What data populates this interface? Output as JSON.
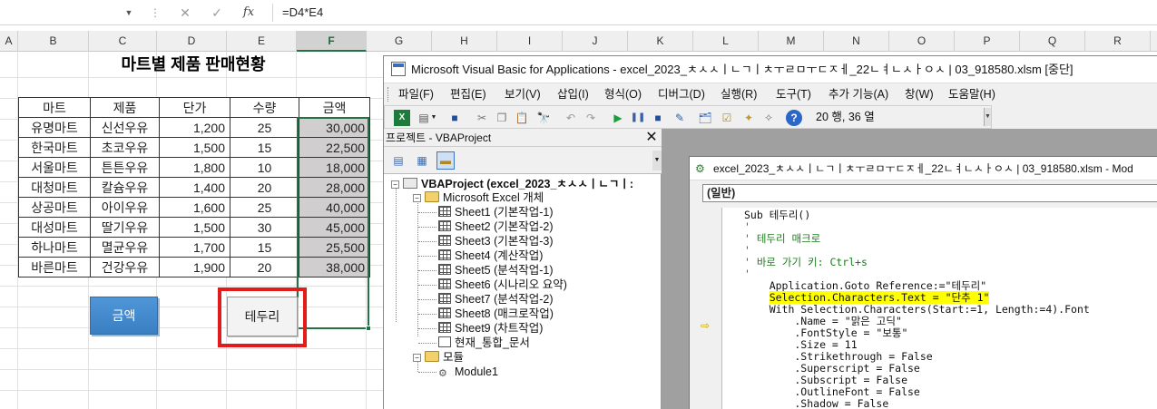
{
  "formula_bar": {
    "cancel_icon": "✕",
    "enter_icon": "✓",
    "fx_label": "fx",
    "formula": "=D4*E4"
  },
  "columns": [
    "A",
    "B",
    "C",
    "D",
    "E",
    "F",
    "G",
    "H",
    "I",
    "J",
    "K",
    "L",
    "M",
    "N",
    "O",
    "P",
    "Q",
    "R"
  ],
  "selected_column": "F",
  "sheet": {
    "title": "마트별 제품 판매현황",
    "headers": [
      "마트",
      "제품",
      "단가",
      "수량",
      "금액"
    ],
    "rows": [
      [
        "유명마트",
        "신선우유",
        "1,200",
        "25",
        "30,000"
      ],
      [
        "한국마트",
        "초코우유",
        "1,500",
        "15",
        "22,500"
      ],
      [
        "서울마트",
        "튼튼우유",
        "1,800",
        "10",
        "18,000"
      ],
      [
        "대청마트",
        "칼슘우유",
        "1,400",
        "20",
        "28,000"
      ],
      [
        "상공마트",
        "아이우유",
        "1,600",
        "25",
        "40,000"
      ],
      [
        "대성마트",
        "딸기우유",
        "1,500",
        "30",
        "45,000"
      ],
      [
        "하나마트",
        "멸균우유",
        "1,700",
        "15",
        "25,500"
      ],
      [
        "바른마트",
        "건강우유",
        "1,900",
        "20",
        "38,000"
      ]
    ],
    "button_amount": "금액",
    "button_border": "테두리"
  },
  "vba": {
    "title": "Microsoft Visual Basic for Applications - excel_2023_ㅊㅅㅅㅣㄴㄱㅣㅊㅜㄹㅁㅜㄷㅈㅔ_22ㄴㅕㄴㅅㅏㅇㅅ | 03_918580.xlsm [중단]",
    "menu": [
      "파일(F)",
      "편집(E)",
      "보기(V)",
      "삽입(I)",
      "형식(O)",
      "디버그(D)",
      "실행(R)",
      "도구(T)",
      "추가 기능(A)",
      "창(W)",
      "도움말(H)"
    ],
    "position": "20 행, 36 열",
    "project": {
      "header": "프로젝트 - VBAProject",
      "root": "VBAProject (excel_2023_ㅊㅅㅅㅣㄴㄱㅣ:",
      "excel_objects": "Microsoft Excel 개체",
      "sheets": [
        "Sheet1 (기본작업-1)",
        "Sheet2 (기본작업-2)",
        "Sheet3 (기본작업-3)",
        "Sheet4 (계산작업)",
        "Sheet5 (분석작업-1)",
        "Sheet6 (시나리오 요약)",
        "Sheet7 (분석작업-2)",
        "Sheet8 (매크로작업)",
        "Sheet9 (차트작업)",
        "현재_통합_문서"
      ],
      "modules_folder": "모듈",
      "module": "Module1"
    },
    "code_window": {
      "title": "excel_2023_ㅊㅅㅅㅣㄴㄱㅣㅊㅜㄹㅁㅜㄷㅈㅔ_22ㄴㅕㄴㅅㅏㅇㅅ | 03_918580.xlsm - Mod",
      "object_combo": "(일반)",
      "lines": [
        "Sub 테두리()",
        "'",
        "' 테두리 매크로",
        "'",
        "' 바로 가기 키: Ctrl+s",
        "'",
        "    Application.Goto Reference:=\"테두리\"",
        "    Selection.Characters.Text = \"단추 1\"",
        "    With Selection.Characters(Start:=1, Length:=4).Font",
        "        .Name = \"맑은 고딕\"",
        "        .FontStyle = \"보통\"",
        "        .Size = 11",
        "        .Strikethrough = False",
        "        .Superscript = False",
        "        .Subscript = False",
        "        .OutlineFont = False",
        "        .Shadow = False"
      ]
    }
  },
  "colors": {
    "excel_green": "#217346",
    "highlight_yellow": "#ffff00",
    "comment_green": "#1b7d1b",
    "red_box": "#e21c1c",
    "amount_button": "#3a7fc2"
  }
}
